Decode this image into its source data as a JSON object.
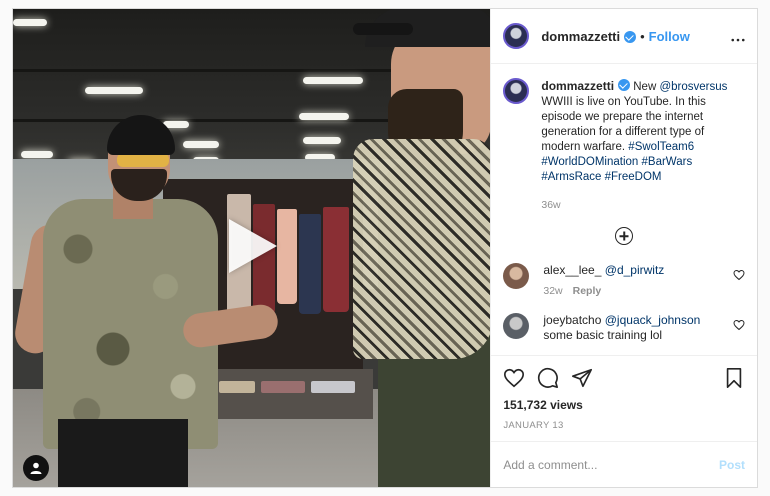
{
  "post": {
    "author": "dommazzetti",
    "follow_label": "Follow",
    "separator": "•",
    "more_label": "•••",
    "caption_lines": [
      {
        "text": "New ",
        "kind": "text"
      },
      {
        "text": "@brosversus",
        "kind": "link"
      },
      {
        "text": " WWIII is live on YouTube. In this episode we prepare the internet generation for a different type of modern warfare. ",
        "kind": "text"
      },
      {
        "text": "#SwolTeam6",
        "kind": "link"
      },
      {
        "text": " ",
        "kind": "text"
      },
      {
        "text": "#WorldDOMination",
        "kind": "link"
      },
      {
        "text": " ",
        "kind": "text"
      },
      {
        "text": "#BarWars",
        "kind": "link"
      },
      {
        "text": " ",
        "kind": "text"
      },
      {
        "text": "#ArmsRace",
        "kind": "link"
      },
      {
        "text": " ",
        "kind": "text"
      },
      {
        "text": "#FreeDOM",
        "kind": "link"
      }
    ],
    "caption_time": "36w",
    "views": "151,732 views",
    "date": "JANUARY 13"
  },
  "comments": [
    {
      "user": "alex__lee_",
      "mention": "@d_pirwitz",
      "text": "",
      "time": "32w",
      "reply": "Reply",
      "avatar_color": "#7a5a4a"
    },
    {
      "user": "joeybatcho",
      "mention": "@jquack_johnson",
      "text": "some basic training lol",
      "time": "",
      "reply": "",
      "avatar_color": "#5a5f66"
    }
  ],
  "composer": {
    "placeholder": "Add a comment...",
    "post_label": "Post"
  },
  "icons": [
    "verified-badge-icon",
    "load-more-icon",
    "heart-icon",
    "comment-icon",
    "share-icon",
    "save-icon",
    "user-tag-icon",
    "play-icon"
  ],
  "colors": {
    "link": "#003569",
    "accent": "#3897f0",
    "muted": "#8e8e8e"
  }
}
